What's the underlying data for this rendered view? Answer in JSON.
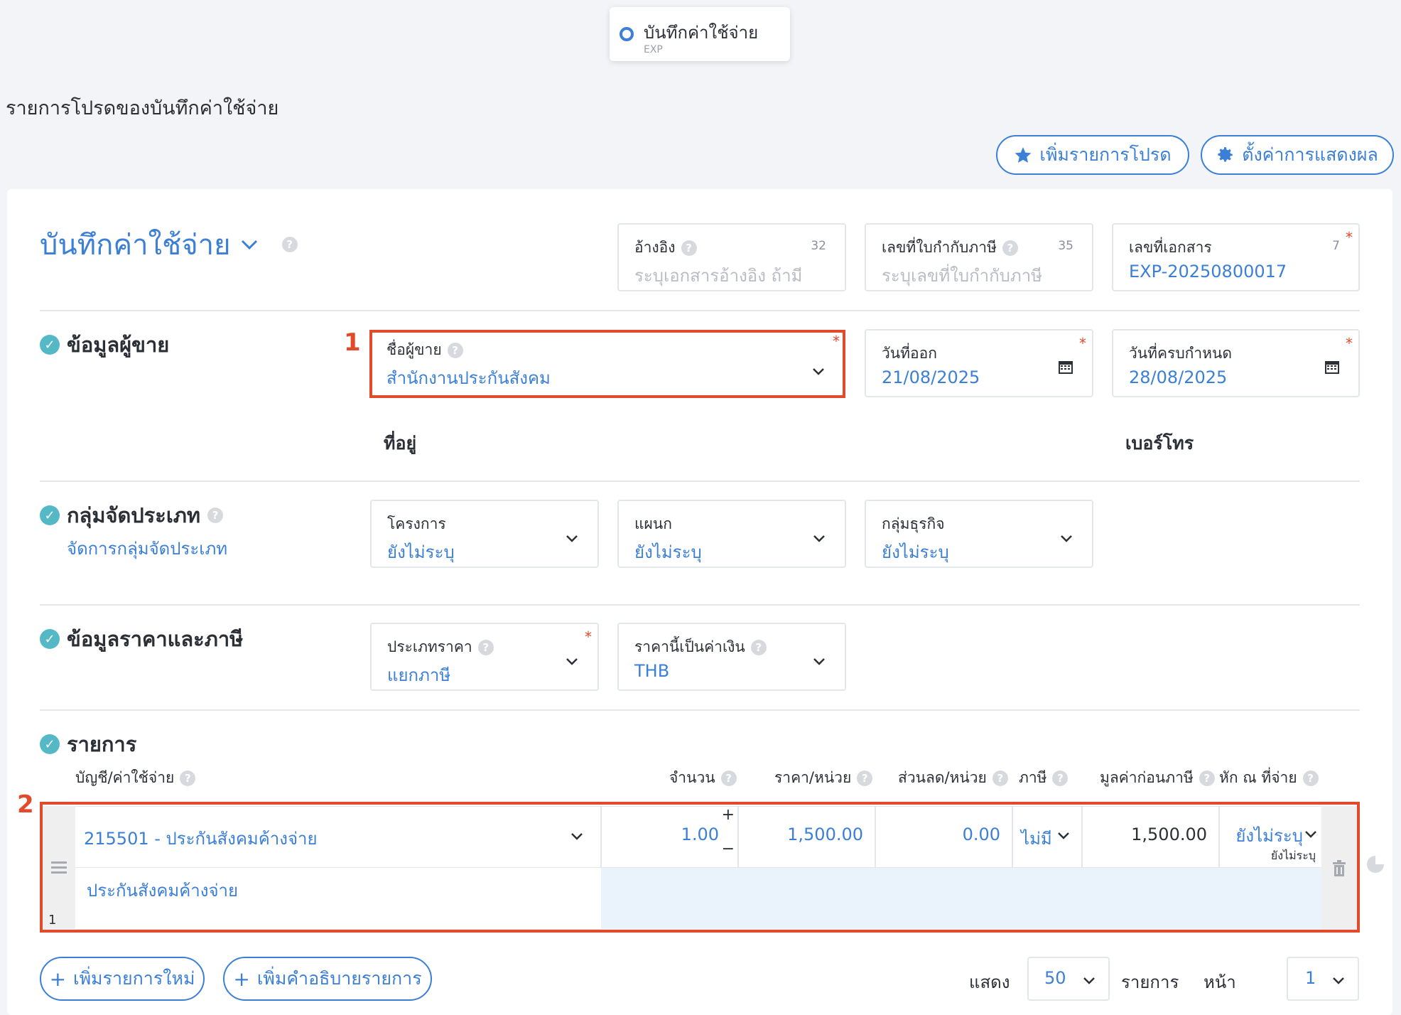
{
  "top_tab": {
    "title": "บันทึกค่าใช้จ่าย",
    "code": "EXP"
  },
  "favorites_title": "รายการโปรดของบันทึกค่าใช้จ่าย",
  "buttons": {
    "add_favorite": "เพิ่มรายการโปรด",
    "display_settings": "ตั้งค่าการแสดงผล"
  },
  "document": {
    "title": "บันทึกค่าใช้จ่าย",
    "reference": {
      "label": "อ้างอิง",
      "placeholder": "ระบุเอกสารอ้างอิง ถ้ามี",
      "counter": "32"
    },
    "tax_invoice_no": {
      "label": "เลขที่ใบกำกับภาษี",
      "placeholder": "ระบุเลขที่ใบกำกับภาษี",
      "counter": "35"
    },
    "doc_no": {
      "label": "เลขที่เอกสาร",
      "value": "EXP-20250800017",
      "counter": "7",
      "required": "*"
    }
  },
  "vendor": {
    "section_title": "ข้อมูลผู้ขาย",
    "marker": "1",
    "name_label": "ชื่อผู้ขาย",
    "name_value": "สำนักงานประกันสังคม",
    "issue_date_label": "วันที่ออก",
    "issue_date": "21/08/2025",
    "due_date_label": "วันที่ครบกำหนด",
    "due_date": "28/08/2025",
    "address_label": "ที่อยู่",
    "phone_label": "เบอร์โทร",
    "required": "*"
  },
  "classification": {
    "section_title": "กลุ่มจัดประเภท",
    "manage_link": "จัดการกลุ่มจัดประเภท",
    "project": {
      "label": "โครงการ",
      "value": "ยังไม่ระบุ"
    },
    "department": {
      "label": "แผนก",
      "value": "ยังไม่ระบุ"
    },
    "business_group": {
      "label": "กลุ่มธุรกิจ",
      "value": "ยังไม่ระบุ"
    }
  },
  "pricing": {
    "section_title": "ข้อมูลราคาและภาษี",
    "price_type": {
      "label": "ประเภทราคา",
      "value": "แยกภาษี",
      "required": "*"
    },
    "currency": {
      "label": "ราคานี้เป็นค่าเงิน",
      "value": "THB"
    }
  },
  "items": {
    "section_title": "รายการ",
    "marker": "2",
    "columns": {
      "account": "บัญชี/ค่าใช้จ่าย",
      "qty": "จำนวน",
      "unit_price": "ราคา/หน่วย",
      "discount": "ส่วนลด/หน่วย",
      "tax": "ภาษี",
      "pretax": "มูลค่าก่อนภาษี",
      "withholding": "หัก ณ ที่จ่าย"
    },
    "row": {
      "index": "1",
      "account": "215501 - ประกันสังคมค้างจ่าย",
      "description": "ประกันสังคมค้างจ่าย",
      "qty": "1.00",
      "unit_price": "1,500.00",
      "discount": "0.00",
      "tax": "ไม่มี",
      "pretax": "1,500.00",
      "withholding": "ยังไม่ระบุ",
      "withholding_sub": "ยังไม่ระบุ"
    }
  },
  "footer": {
    "add_item": "เพิ่มรายการใหม่",
    "add_description": "เพิ่มคำอธิบายรายการ",
    "show_label": "แสดง",
    "per_page": "50",
    "items_label": "รายการ",
    "page_label": "หน้า",
    "page": "1"
  },
  "colors": {
    "accent": "#3b7fd6",
    "highlight": "#e14a2b",
    "check": "#55b8c6"
  }
}
